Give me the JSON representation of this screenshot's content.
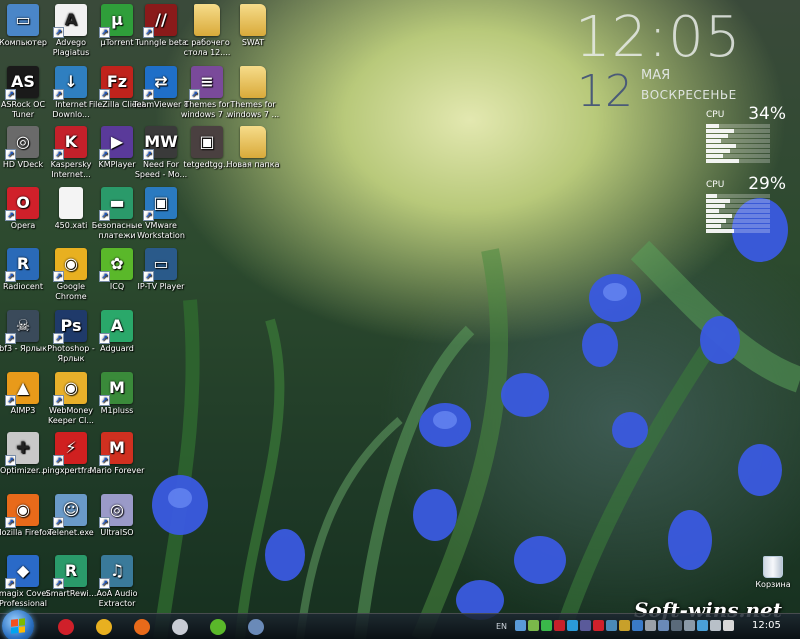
{
  "clock": {
    "time": "12:05",
    "day": "12",
    "month": "МАЯ",
    "weekday": "ВОСКРЕСЕНЬЕ"
  },
  "cpu_gadgets": [
    {
      "label": "CPU",
      "value": "34%",
      "fraction": 0.34
    },
    {
      "label": "CPU",
      "value": "29%",
      "fraction": 0.29
    }
  ],
  "icons": [
    {
      "label": "Компьютер",
      "icon": "computer-icon",
      "color": "#4a86c8",
      "glyph": "▭"
    },
    {
      "label": "Advego Plagiatus",
      "icon": "advego-icon",
      "color": "#f2f2f2",
      "glyph": "A"
    },
    {
      "label": "µTorrent",
      "icon": "utorrent-icon",
      "color": "#2f9e3a",
      "glyph": "µ"
    },
    {
      "label": "Tunngle beta",
      "icon": "tunngle-icon",
      "color": "#8a1a1a",
      "glyph": "//"
    },
    {
      "label": "с рабочего стола 12....",
      "icon": "folder-icon",
      "color": "#e8c15a",
      "glyph": ""
    },
    {
      "label": "SWAT",
      "icon": "folder-icon",
      "color": "#e8c15a",
      "glyph": ""
    },
    {
      "label": "ASRock OC Tuner",
      "icon": "asrock-icon",
      "color": "#1a1a1a",
      "glyph": "AS"
    },
    {
      "label": "Internet Downlo...",
      "icon": "idm-icon",
      "color": "#2f7fc0",
      "glyph": "↓"
    },
    {
      "label": "FileZilla Client",
      "icon": "filezilla-icon",
      "color": "#c0231c",
      "glyph": "Fz"
    },
    {
      "label": "TeamViewer 8",
      "icon": "teamviewer-icon",
      "color": "#1f6fc8",
      "glyph": "⇄"
    },
    {
      "label": "Themes for windows 7 ...",
      "icon": "themes-icon",
      "color": "#7a4a9a",
      "glyph": "≡"
    },
    {
      "label": "Themes for windows 7 ...",
      "icon": "folder-icon",
      "color": "#e8c15a",
      "glyph": ""
    },
    {
      "label": "HD VDeck",
      "icon": "hdvdeck-icon",
      "color": "#6a6a6a",
      "glyph": "◎"
    },
    {
      "label": "Kaspersky Internet...",
      "icon": "kaspersky-icon",
      "color": "#c4202a",
      "glyph": "K"
    },
    {
      "label": "KMPlayer",
      "icon": "kmplayer-icon",
      "color": "#5a3a9a",
      "glyph": "▶"
    },
    {
      "label": "Need For Speed - Mo...",
      "icon": "nfs-icon",
      "color": "#3a3a3a",
      "glyph": "MW"
    },
    {
      "label": "tetgedtgg...",
      "icon": "image-file-icon",
      "color": "#4a4040",
      "glyph": "▣"
    },
    {
      "label": "Новая папка",
      "icon": "folder-icon",
      "color": "#e8c15a",
      "glyph": ""
    },
    {
      "label": "Opera",
      "icon": "opera-icon",
      "color": "#d0202a",
      "glyph": "O"
    },
    {
      "label": "450.xati",
      "icon": "file-icon",
      "color": "#f4f4f4",
      "glyph": ""
    },
    {
      "label": "Безопасные платежи",
      "icon": "safe-payments-icon",
      "color": "#2a9a6a",
      "glyph": "▬"
    },
    {
      "label": "VMware Workstation",
      "icon": "vmware-icon",
      "color": "#2a7ac0",
      "glyph": "▣"
    },
    {
      "label": "Radiocent",
      "icon": "radiocent-icon",
      "color": "#2a6ab8",
      "glyph": "R"
    },
    {
      "label": "Google Chrome",
      "icon": "chrome-icon",
      "color": "#e8b020",
      "glyph": "◉"
    },
    {
      "label": "ICQ",
      "icon": "icq-icon",
      "color": "#5ab82a",
      "glyph": "✿"
    },
    {
      "label": "IP-TV Player",
      "icon": "iptv-icon",
      "color": "#2a5a8a",
      "glyph": "▭"
    },
    {
      "label": "bf3 - Ярлык",
      "icon": "bf3-icon",
      "color": "#3a4a5a",
      "glyph": "☠"
    },
    {
      "label": "Photoshop - Ярлык",
      "icon": "photoshop-icon",
      "color": "#1f3a6a",
      "glyph": "Ps"
    },
    {
      "label": "Adguard",
      "icon": "adguard-icon",
      "color": "#2aa86a",
      "glyph": "A"
    },
    {
      "label": "AIMP3",
      "icon": "aimp-icon",
      "color": "#e89a1a",
      "glyph": "▲"
    },
    {
      "label": "WebMoney Keeper Cl...",
      "icon": "webmoney-icon",
      "color": "#e8b02a",
      "glyph": "◉"
    },
    {
      "label": "M1pluss",
      "icon": "m1pluss-icon",
      "color": "#3a8a3a",
      "glyph": "M"
    },
    {
      "label": "Optimizer...",
      "icon": "optimizer-icon",
      "color": "#c8c8c8",
      "glyph": "✚"
    },
    {
      "label": "pingxpertfra...",
      "icon": "pingxpert-icon",
      "color": "#d02020",
      "glyph": "⚡"
    },
    {
      "label": "Mario Forever",
      "icon": "mario-icon",
      "color": "#d03020",
      "glyph": "M"
    },
    {
      "label": "Mozilla Firefox",
      "icon": "firefox-icon",
      "color": "#e86a1a",
      "glyph": "◉"
    },
    {
      "label": "Telenet.exe",
      "icon": "telenet-icon",
      "color": "#6a9ac8",
      "glyph": "☺"
    },
    {
      "label": "UltraISO",
      "icon": "ultraiso-icon",
      "color": "#9a9ac8",
      "glyph": "◎"
    },
    {
      "label": "Imagix Cover Professional",
      "icon": "imagix-icon",
      "color": "#2a6ac8",
      "glyph": "◆"
    },
    {
      "label": "SmartRewi...",
      "icon": "smartrewind-icon",
      "color": "#2a9a6a",
      "glyph": "R"
    },
    {
      "label": "AoA Audio Extractor",
      "icon": "aoa-icon",
      "color": "#3a7a9a",
      "glyph": "♫"
    }
  ],
  "recycle_bin": {
    "label": "Корзина",
    "icon": "recycle-bin-icon"
  },
  "watermark": "Soft-wins.net",
  "taskbar": {
    "start_icon": "windows-start-icon",
    "items": [
      {
        "icon": "opera-icon",
        "color": "#d0202a"
      },
      {
        "icon": "chrome-icon",
        "color": "#e8b020"
      },
      {
        "icon": "firefox-icon",
        "color": "#e86a1a"
      },
      {
        "icon": "mail-icon",
        "color": "#c8ccd4"
      },
      {
        "icon": "icq-icon",
        "color": "#5ab82a"
      },
      {
        "icon": "iptv-icon",
        "color": "#6a8ab8"
      }
    ],
    "language": "EN",
    "tray_icons": [
      "network-icon",
      "volume-icon",
      "utorrent-tray-icon",
      "kaspersky-tray-icon",
      "skype-tray-icon",
      "ru-tray-icon",
      "opera-tray-icon",
      "shield-tray-icon",
      "update-icon",
      "flag-icon",
      "sound-icon",
      "monitor-icon",
      "power-icon",
      "printer-icon",
      "chat-icon",
      "wifi-icon",
      "speaker-icon"
    ],
    "tray_colors": [
      "#5a9ad8",
      "#7ab84a",
      "#3ab84a",
      "#c8202a",
      "#2a9ad8",
      "#5a5a9a",
      "#d0202a",
      "#4a8ab8",
      "#c8a02a",
      "#3a7ac8",
      "#9aa0a8",
      "#6a8ab8",
      "#5a6a7a",
      "#8a9aa8",
      "#4aa0d8",
      "#b8c0c8",
      "#d8d8d8"
    ],
    "clock": "12:05"
  }
}
